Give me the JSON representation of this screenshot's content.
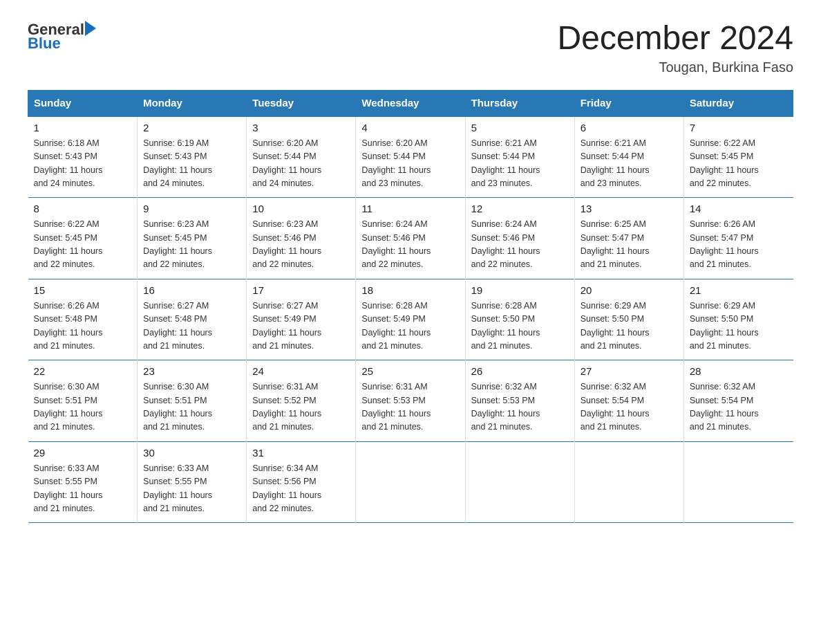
{
  "logo": {
    "general": "General",
    "blue": "Blue"
  },
  "title": "December 2024",
  "location": "Tougan, Burkina Faso",
  "days_of_week": [
    "Sunday",
    "Monday",
    "Tuesday",
    "Wednesday",
    "Thursday",
    "Friday",
    "Saturday"
  ],
  "weeks": [
    [
      {
        "day": "1",
        "sunrise": "6:18 AM",
        "sunset": "5:43 PM",
        "daylight": "11 hours and 24 minutes."
      },
      {
        "day": "2",
        "sunrise": "6:19 AM",
        "sunset": "5:43 PM",
        "daylight": "11 hours and 24 minutes."
      },
      {
        "day": "3",
        "sunrise": "6:20 AM",
        "sunset": "5:44 PM",
        "daylight": "11 hours and 24 minutes."
      },
      {
        "day": "4",
        "sunrise": "6:20 AM",
        "sunset": "5:44 PM",
        "daylight": "11 hours and 23 minutes."
      },
      {
        "day": "5",
        "sunrise": "6:21 AM",
        "sunset": "5:44 PM",
        "daylight": "11 hours and 23 minutes."
      },
      {
        "day": "6",
        "sunrise": "6:21 AM",
        "sunset": "5:44 PM",
        "daylight": "11 hours and 23 minutes."
      },
      {
        "day": "7",
        "sunrise": "6:22 AM",
        "sunset": "5:45 PM",
        "daylight": "11 hours and 22 minutes."
      }
    ],
    [
      {
        "day": "8",
        "sunrise": "6:22 AM",
        "sunset": "5:45 PM",
        "daylight": "11 hours and 22 minutes."
      },
      {
        "day": "9",
        "sunrise": "6:23 AM",
        "sunset": "5:45 PM",
        "daylight": "11 hours and 22 minutes."
      },
      {
        "day": "10",
        "sunrise": "6:23 AM",
        "sunset": "5:46 PM",
        "daylight": "11 hours and 22 minutes."
      },
      {
        "day": "11",
        "sunrise": "6:24 AM",
        "sunset": "5:46 PM",
        "daylight": "11 hours and 22 minutes."
      },
      {
        "day": "12",
        "sunrise": "6:24 AM",
        "sunset": "5:46 PM",
        "daylight": "11 hours and 22 minutes."
      },
      {
        "day": "13",
        "sunrise": "6:25 AM",
        "sunset": "5:47 PM",
        "daylight": "11 hours and 21 minutes."
      },
      {
        "day": "14",
        "sunrise": "6:26 AM",
        "sunset": "5:47 PM",
        "daylight": "11 hours and 21 minutes."
      }
    ],
    [
      {
        "day": "15",
        "sunrise": "6:26 AM",
        "sunset": "5:48 PM",
        "daylight": "11 hours and 21 minutes."
      },
      {
        "day": "16",
        "sunrise": "6:27 AM",
        "sunset": "5:48 PM",
        "daylight": "11 hours and 21 minutes."
      },
      {
        "day": "17",
        "sunrise": "6:27 AM",
        "sunset": "5:49 PM",
        "daylight": "11 hours and 21 minutes."
      },
      {
        "day": "18",
        "sunrise": "6:28 AM",
        "sunset": "5:49 PM",
        "daylight": "11 hours and 21 minutes."
      },
      {
        "day": "19",
        "sunrise": "6:28 AM",
        "sunset": "5:50 PM",
        "daylight": "11 hours and 21 minutes."
      },
      {
        "day": "20",
        "sunrise": "6:29 AM",
        "sunset": "5:50 PM",
        "daylight": "11 hours and 21 minutes."
      },
      {
        "day": "21",
        "sunrise": "6:29 AM",
        "sunset": "5:50 PM",
        "daylight": "11 hours and 21 minutes."
      }
    ],
    [
      {
        "day": "22",
        "sunrise": "6:30 AM",
        "sunset": "5:51 PM",
        "daylight": "11 hours and 21 minutes."
      },
      {
        "day": "23",
        "sunrise": "6:30 AM",
        "sunset": "5:51 PM",
        "daylight": "11 hours and 21 minutes."
      },
      {
        "day": "24",
        "sunrise": "6:31 AM",
        "sunset": "5:52 PM",
        "daylight": "11 hours and 21 minutes."
      },
      {
        "day": "25",
        "sunrise": "6:31 AM",
        "sunset": "5:53 PM",
        "daylight": "11 hours and 21 minutes."
      },
      {
        "day": "26",
        "sunrise": "6:32 AM",
        "sunset": "5:53 PM",
        "daylight": "11 hours and 21 minutes."
      },
      {
        "day": "27",
        "sunrise": "6:32 AM",
        "sunset": "5:54 PM",
        "daylight": "11 hours and 21 minutes."
      },
      {
        "day": "28",
        "sunrise": "6:32 AM",
        "sunset": "5:54 PM",
        "daylight": "11 hours and 21 minutes."
      }
    ],
    [
      {
        "day": "29",
        "sunrise": "6:33 AM",
        "sunset": "5:55 PM",
        "daylight": "11 hours and 21 minutes."
      },
      {
        "day": "30",
        "sunrise": "6:33 AM",
        "sunset": "5:55 PM",
        "daylight": "11 hours and 21 minutes."
      },
      {
        "day": "31",
        "sunrise": "6:34 AM",
        "sunset": "5:56 PM",
        "daylight": "11 hours and 22 minutes."
      },
      null,
      null,
      null,
      null
    ]
  ],
  "sunrise_label": "Sunrise:",
  "sunset_label": "Sunset:",
  "daylight_label": "Daylight:"
}
